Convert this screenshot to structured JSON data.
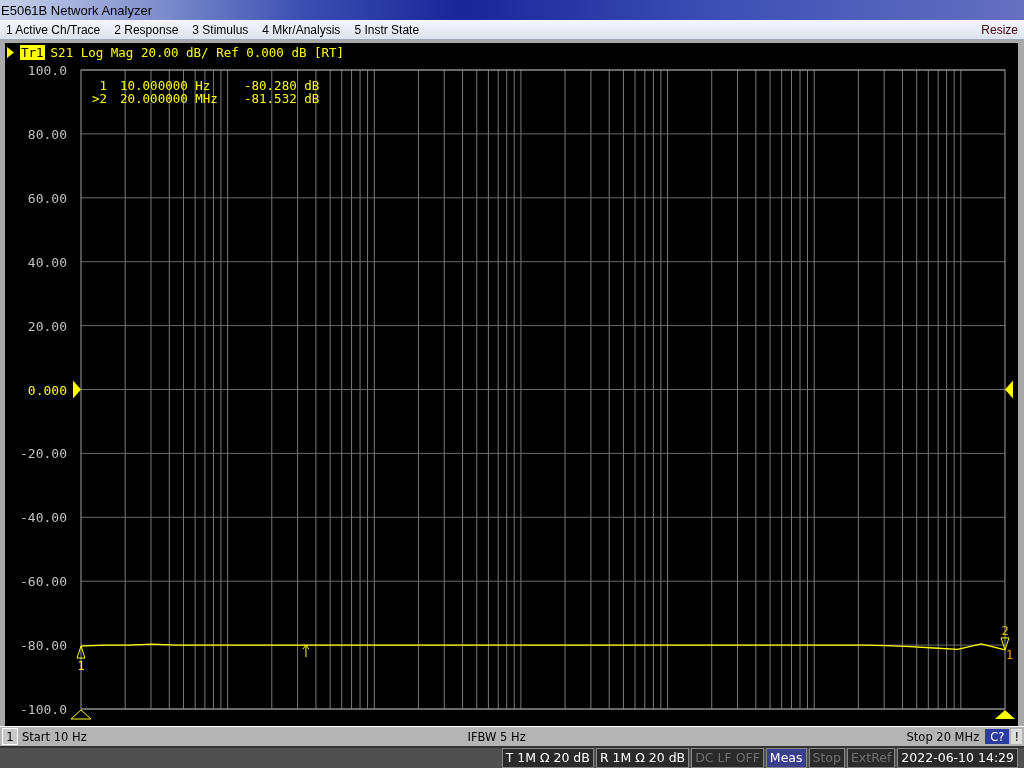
{
  "window": {
    "title": "E5061B Network Analyzer"
  },
  "menu": {
    "items": [
      {
        "label": "1 Active Ch/Trace"
      },
      {
        "label": "2 Response"
      },
      {
        "label": "3 Stimulus"
      },
      {
        "label": "4 Mkr/Analysis"
      },
      {
        "label": "5 Instr State"
      }
    ],
    "resize": "Resize"
  },
  "trace_header": {
    "text": "S21 Log Mag 20.00 dB/ Ref 0.000 dB [RT]"
  },
  "marker_readout": [
    {
      "label": "1",
      "stimulus": "10.000000 Hz",
      "response": "-80.280 dB"
    },
    {
      "label": ">2",
      "stimulus": "20.000000 MHz",
      "response": "-81.532 dB"
    }
  ],
  "chart": {
    "chart_data": {
      "type": "line",
      "grid": true,
      "ylim": [
        -100,
        100
      ],
      "yticks": [
        {
          "value": 100,
          "label": "100.0"
        },
        {
          "value": 80,
          "label": "80.00"
        },
        {
          "value": 60,
          "label": "60.00"
        },
        {
          "value": 40,
          "label": "40.00"
        },
        {
          "value": 20,
          "label": "20.00"
        },
        {
          "value": 0,
          "label": "0.000"
        },
        {
          "value": -20,
          "label": "-20.00"
        },
        {
          "value": -40,
          "label": "-40.00"
        },
        {
          "value": -60,
          "label": "-60.00"
        },
        {
          "value": -80,
          "label": "-80.00"
        },
        {
          "value": -100,
          "label": "-100.0"
        }
      ],
      "categories": [
        null,
        null,
        null,
        null,
        null,
        null,
        null,
        null,
        null,
        null,
        null,
        null,
        null,
        null,
        null,
        null,
        null,
        null,
        null,
        null,
        null,
        null,
        null,
        null,
        null,
        null,
        null,
        null,
        null,
        null,
        null,
        null,
        null,
        null,
        null,
        null,
        null,
        null,
        null,
        null
      ],
      "series": [
        {
          "name": "Tr1",
          "color": "#ffff00",
          "values": [
            -80.3,
            -80.0,
            -80.0,
            -79.7,
            -80.0,
            -80.0,
            -80.0,
            -80.0,
            -80.0,
            -80.0,
            -80.0,
            -80.0,
            -80.0,
            -80.0,
            -80.0,
            -80.0,
            -80.0,
            -80.0,
            -80.0,
            -80.0,
            -80.0,
            -80.0,
            -80.0,
            -80.0,
            -80.0,
            -80.0,
            -80.0,
            -80.0,
            -80.0,
            -80.0,
            -80.0,
            -80.0,
            -80.0,
            -80.0,
            -80.2,
            -80.5,
            -80.9,
            -81.3,
            -79.6,
            -81.5
          ]
        }
      ]
    },
    "markers": [
      {
        "kind": "marker_up",
        "text": "1"
      },
      {
        "kind": "arrow"
      },
      {
        "kind": "marker_down",
        "text": "2"
      },
      {
        "kind": "label_right",
        "text": "1"
      }
    ]
  },
  "status_bar": {
    "channel": "1",
    "start": "Start 10 Hz",
    "ifbw": "IFBW 5 Hz",
    "stop": "Stop 20 MHz",
    "cal": "C?",
    "alert": "!"
  },
  "indicator_bar": {
    "indicators": [
      {
        "text": "T 1M Ω 20 dB",
        "kind": "normal"
      },
      {
        "text": "R 1M Ω 20 dB",
        "kind": "normal"
      },
      {
        "text": "DC LF OFF",
        "kind": "disabled"
      },
      {
        "text": "Meas",
        "kind": "active"
      },
      {
        "text": "Stop",
        "kind": "disabled"
      },
      {
        "text": "ExtRef",
        "kind": "disabled"
      }
    ],
    "datetime": "2022-06-10 14:29"
  }
}
